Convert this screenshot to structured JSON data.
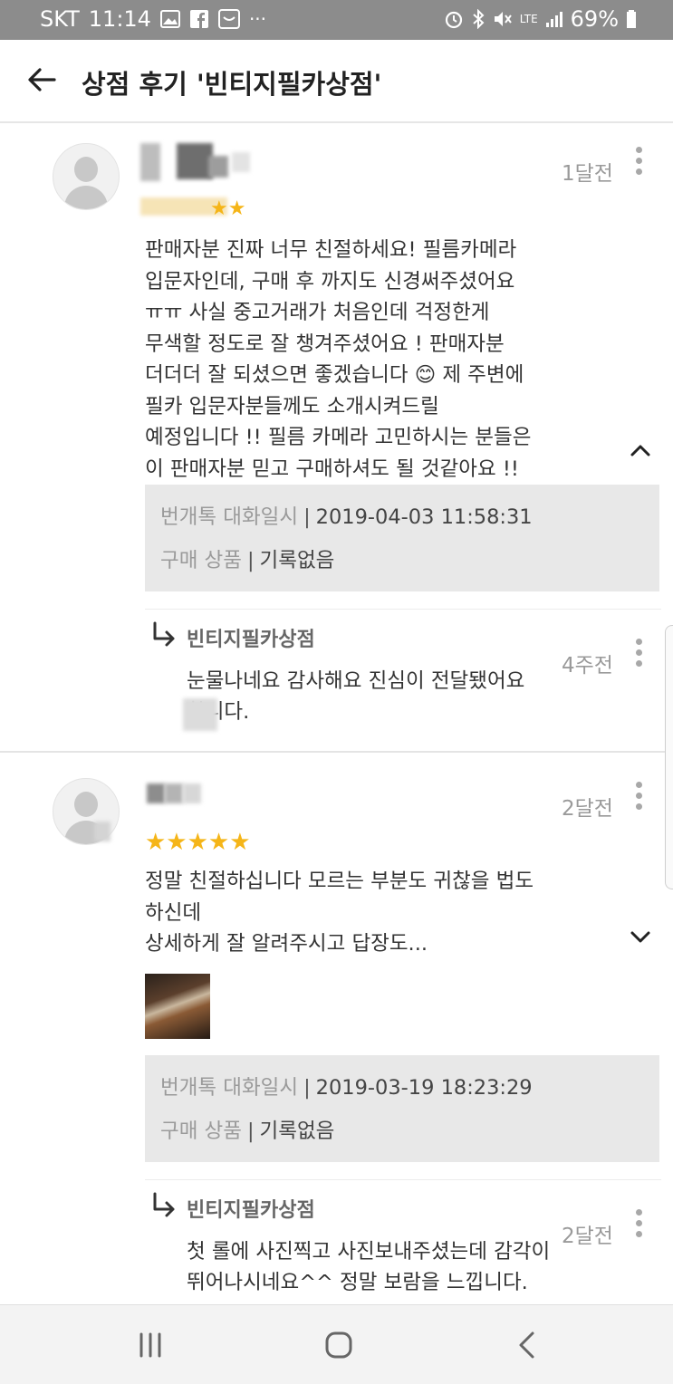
{
  "status_bar": {
    "carrier": "SKT",
    "time": "11:14",
    "network": "LTE",
    "battery": "69%",
    "left_icons": [
      "gallery-icon",
      "facebook-icon",
      "inbox-icon",
      "more-notifications-icon"
    ],
    "right_icons": [
      "alarm-icon",
      "bluetooth-icon",
      "mute-icon",
      "signal-icon",
      "battery-icon"
    ]
  },
  "header": {
    "title": "상점 후기 '빈티지필카상점'"
  },
  "reviews": [
    {
      "time": "1달전",
      "rating": 5,
      "stars": "★★★★★",
      "text": "판매자분 진짜 너무 친절하세요! 필름카메라\n입문자인데, 구매 후 까지도 신경써주셨어요\nㅠㅠ 사실 중고거래가 처음인데 걱정한게\n무색할 정도로 잘 챙겨주셨어요 ! 판매자분\n더더더 잘 되셨으면 좋겠습니다 😊 제 주변에\n필카 입문자분들께도 소개시켜드릴\n예정입니다 !! 필름 카메라 고민하시는 분들은\n이 판매자분 믿고 구매하셔도 될 것같아요 !!",
      "info": {
        "chat_label": "번개톡 대화일시",
        "chat_value": "2019-04-03 11:58:31",
        "product_label": "구매 상품",
        "product_value": "기록없음",
        "separator": "|"
      },
      "reply": {
        "name": "빈티지필카상점",
        "time": "4주전",
        "text": "눈물나네요 감사해요 진심이 전달됐어요\n합니다."
      }
    },
    {
      "time": "2달전",
      "rating": 5,
      "stars": "★★★★★",
      "text": "정말 친절하십니다 모르는 부분도 귀찮을 법도\n하신데\n상세하게 잘 알려주시고 답장도...",
      "info": {
        "chat_label": "번개톡 대화일시",
        "chat_value": "2019-03-19 18:23:29",
        "product_label": "구매 상품",
        "product_value": "기록없음",
        "separator": "|"
      },
      "reply": {
        "name": "빈티지필카상점",
        "time": "2달전",
        "text": "첫 롤에 사진찍고 사진보내주셨는데 감각이\n뛰어나시네요^^ 정말 보람을 느낍니다."
      }
    }
  ],
  "colors": {
    "status_bar": "#8c8c8c",
    "star": "#f5b518",
    "info_box": "#e8e8e8",
    "nav_bar": "#f3f3f3"
  }
}
